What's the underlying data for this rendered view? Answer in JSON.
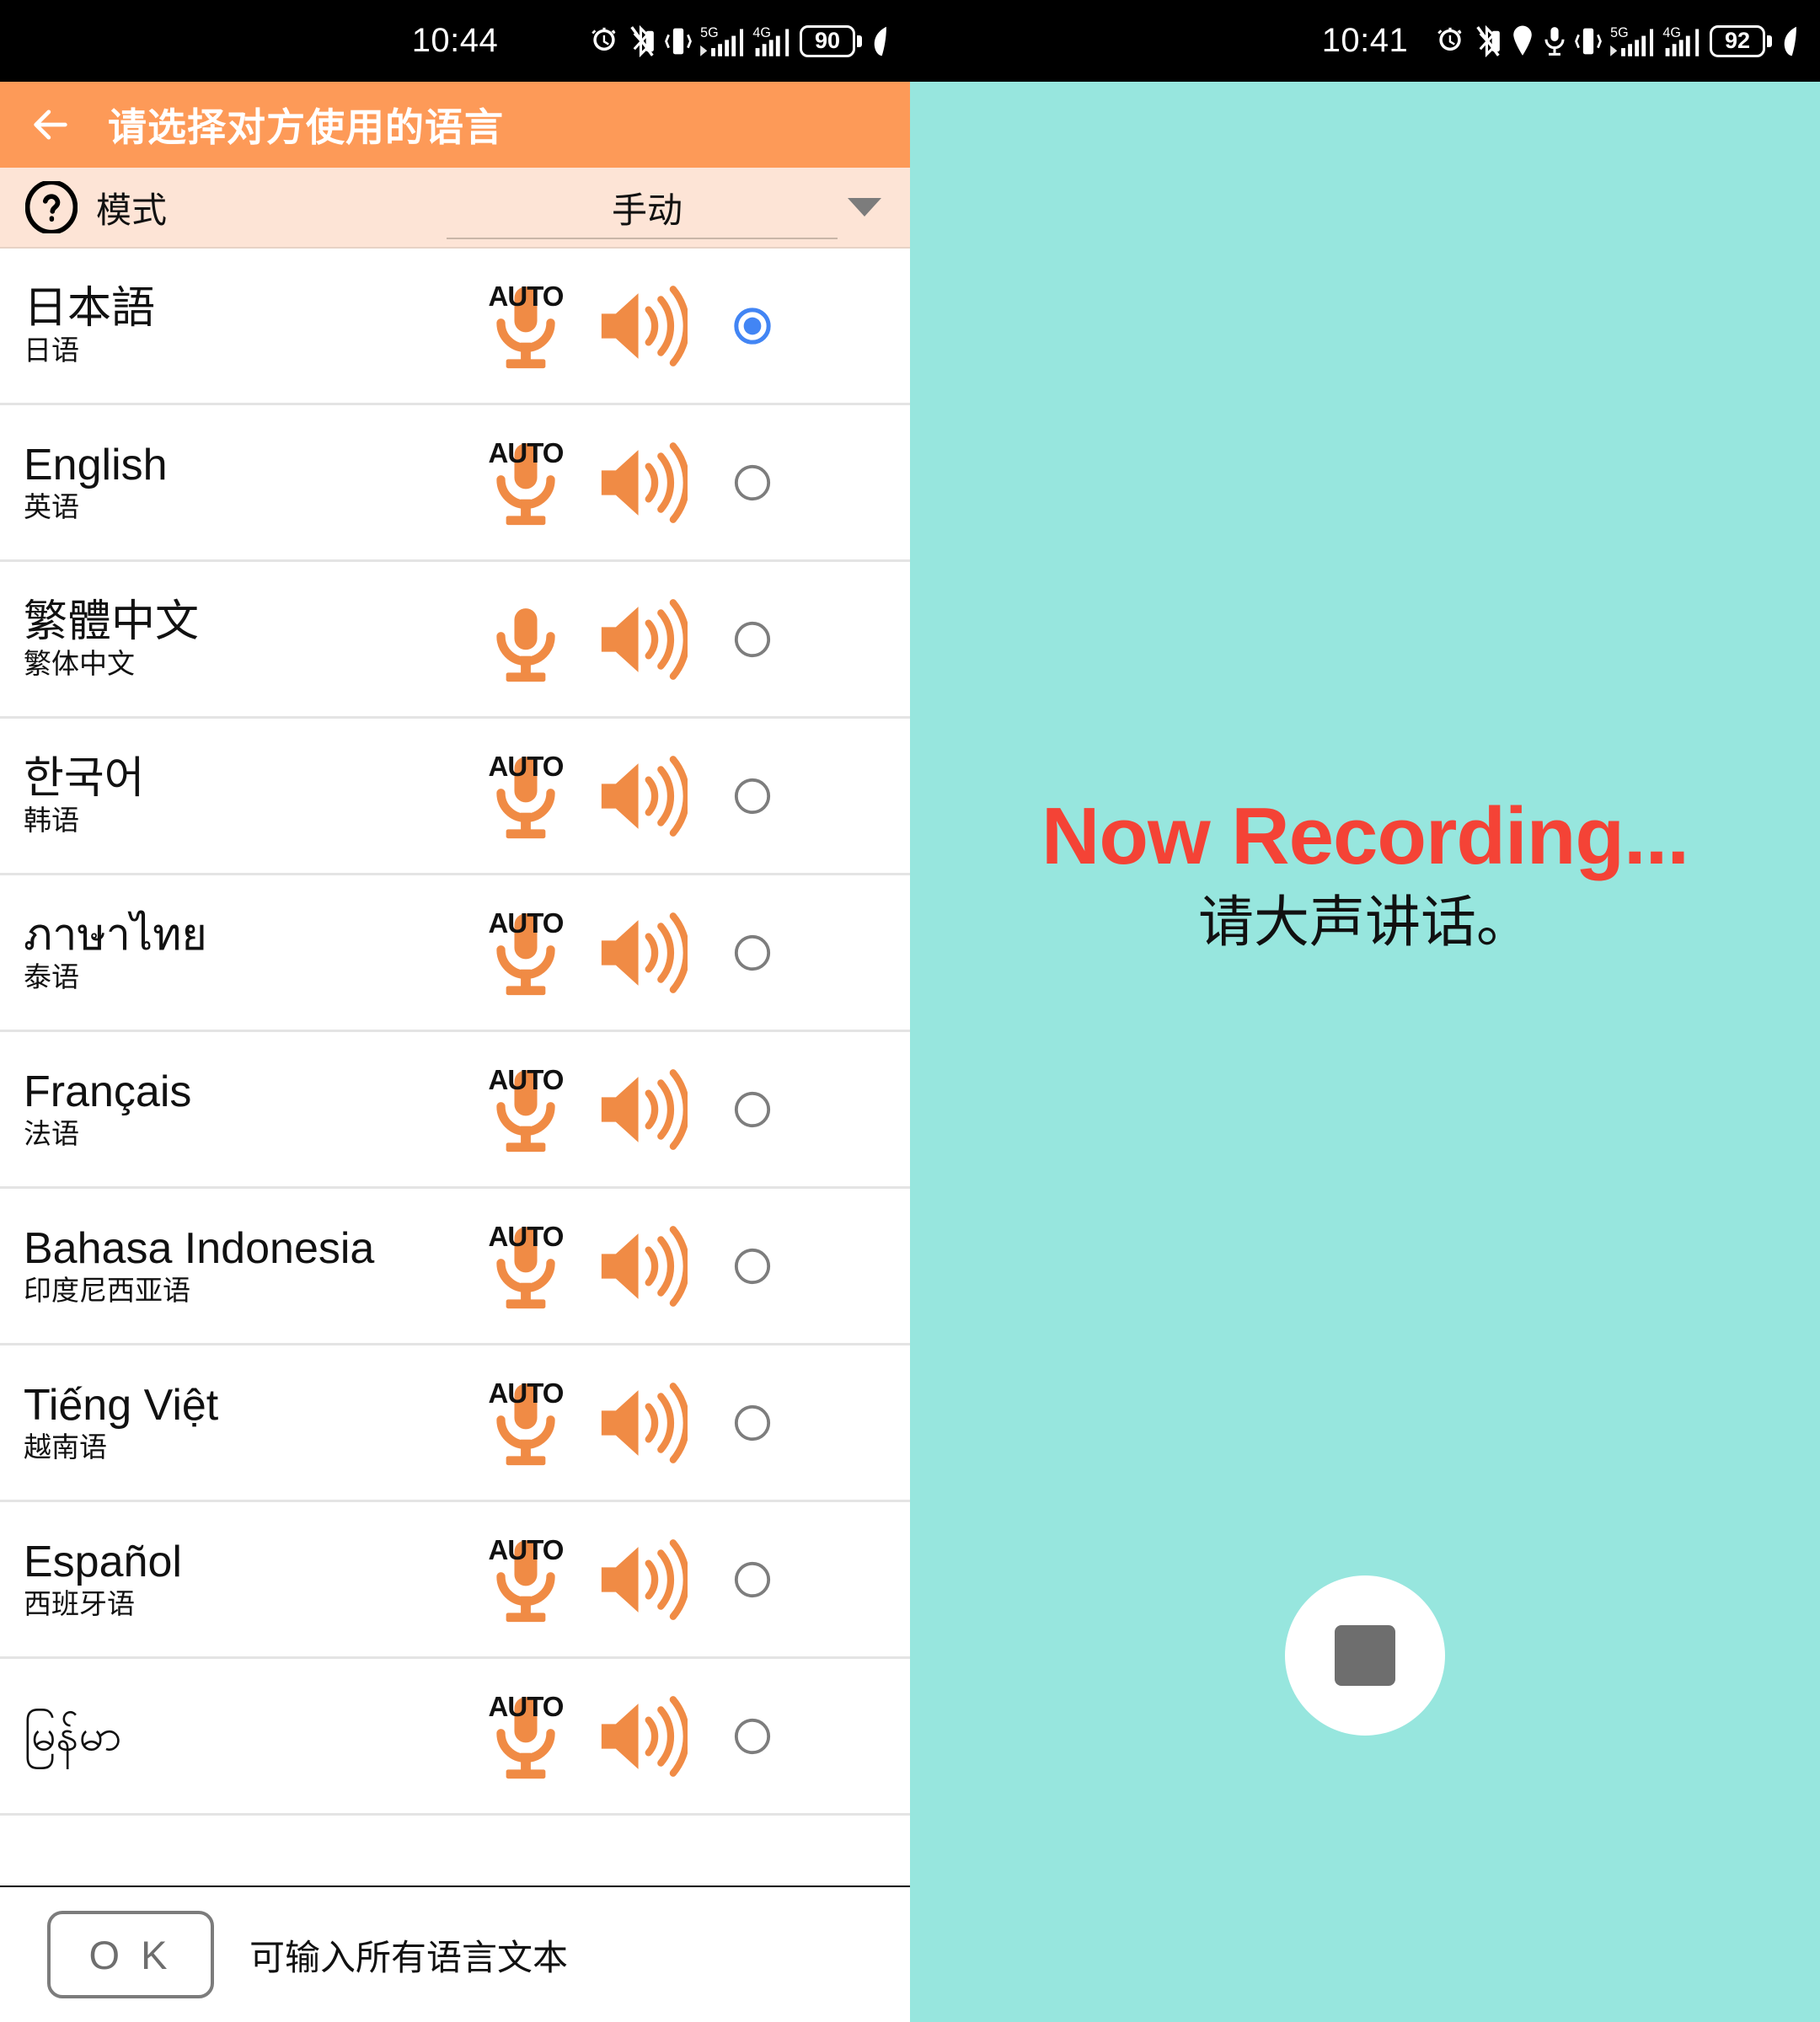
{
  "left": {
    "status_bar": {
      "clock": "10:44",
      "battery": "90",
      "icons": [
        "alarm-icon",
        "bluetooth-muted-icon",
        "vibrate-icon",
        "signal-5g-icon",
        "signal-4g-icon",
        "battery-icon",
        "leaf-icon"
      ]
    },
    "appbar": {
      "back_icon": "back-arrow-icon",
      "title": "请选择对方使用的语言"
    },
    "mode_bar": {
      "help_icon": "help-question-icon",
      "label": "模式",
      "value": "手动",
      "caret_icon": "chevron-down-icon"
    },
    "languages": [
      {
        "native": "日本語",
        "zh": "日语",
        "auto": "AUTO",
        "has_auto": true,
        "selected": true
      },
      {
        "native": "English",
        "zh": "英语",
        "auto": "AUTO",
        "has_auto": true,
        "selected": false
      },
      {
        "native": "繁體中文",
        "zh": "繁体中文",
        "auto": "",
        "has_auto": false,
        "selected": false
      },
      {
        "native": "한국어",
        "zh": "韩语",
        "auto": "AUTO",
        "has_auto": true,
        "selected": false
      },
      {
        "native": "ภาษาไทย",
        "zh": "泰语",
        "auto": "AUTO",
        "has_auto": true,
        "selected": false
      },
      {
        "native": "Français",
        "zh": "法语",
        "auto": "AUTO",
        "has_auto": true,
        "selected": false
      },
      {
        "native": "Bahasa Indonesia",
        "zh": "印度尼西亚语",
        "auto": "AUTO",
        "has_auto": true,
        "selected": false
      },
      {
        "native": "Tiếng Việt",
        "zh": "越南语",
        "auto": "AUTO",
        "has_auto": true,
        "selected": false
      },
      {
        "native": "Español",
        "zh": "西班牙语",
        "auto": "AUTO",
        "has_auto": true,
        "selected": false
      },
      {
        "native": "မြန်မာ",
        "zh": "",
        "auto": "AUTO",
        "has_auto": true,
        "selected": false
      }
    ],
    "bottom_bar": {
      "ok_label": "O K",
      "hint": "可输入所有语言文本"
    }
  },
  "right": {
    "status_bar": {
      "clock": "10:41",
      "battery": "92",
      "icons": [
        "alarm-icon",
        "bluetooth-muted-icon",
        "location-icon",
        "microphone-icon",
        "vibrate-icon",
        "signal-5g-icon",
        "signal-4g-icon",
        "battery-icon",
        "leaf-icon"
      ]
    },
    "recording": {
      "title": "Now Recording...",
      "subtitle": "请大声讲话。",
      "stop_icon": "stop-square-icon"
    }
  },
  "colors": {
    "appbar_orange": "#FD9A58",
    "modebar_peach": "#FDE4D6",
    "teal_background": "#97E6DE",
    "recording_red": "#F44336",
    "icon_orange": "#F08B45",
    "radio_blue": "#4285F4"
  }
}
